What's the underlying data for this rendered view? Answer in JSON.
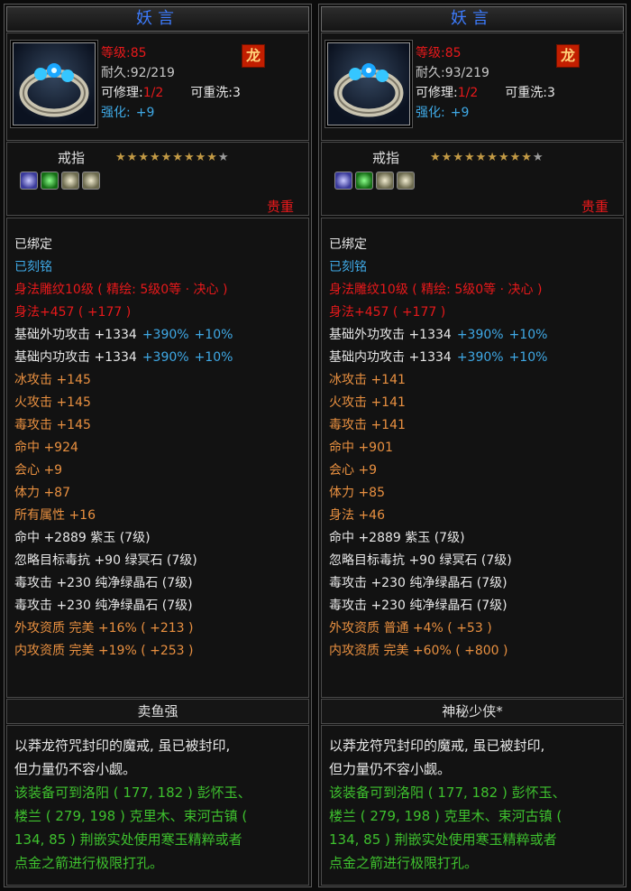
{
  "panels": [
    {
      "title": "妖言",
      "level": "等级:85",
      "durability": "耐久:92/219",
      "repair_label": "可修理:",
      "repair_value": "1/2",
      "rewash": "可重洗:3",
      "enhance_label": "强化:",
      "enhance_value": "+9",
      "emblem_icon": "dragon-icon",
      "type": "戒指",
      "stars_on": 9,
      "stars_total": 10,
      "grade": "贵重",
      "lines": [
        [
          {
            "t": "已绑定",
            "c": "wht"
          }
        ],
        [
          {
            "t": "已刻铭",
            "c": "cyn"
          }
        ],
        [
          {
            "t": "身法雕纹10级 ( 精绘: 5级0等 · 决心 )",
            "c": "red"
          }
        ],
        [
          {
            "t": "身法+457 ( +177 )",
            "c": "red"
          }
        ],
        [
          {
            "t": "基础外功攻击  +1334",
            "c": "wht"
          },
          {
            "t": "+390%",
            "c": "cyn"
          },
          {
            "t": "+10%",
            "c": "cyn"
          }
        ],
        [
          {
            "t": "基础内功攻击  +1334",
            "c": "wht"
          },
          {
            "t": "+390%",
            "c": "cyn"
          },
          {
            "t": "+10%",
            "c": "cyn"
          }
        ],
        [
          {
            "t": "冰攻击  +145",
            "c": "org"
          }
        ],
        [
          {
            "t": "火攻击  +145",
            "c": "org"
          }
        ],
        [
          {
            "t": "毒攻击  +145",
            "c": "org"
          }
        ],
        [
          {
            "t": "命中  +924",
            "c": "org"
          }
        ],
        [
          {
            "t": "会心  +9",
            "c": "org"
          }
        ],
        [
          {
            "t": "体力  +87",
            "c": "org"
          }
        ],
        [
          {
            "t": "所有属性  +16",
            "c": "org"
          }
        ],
        [
          {
            "t": "命中  +2889  紫玉 (7级)",
            "c": "wht"
          }
        ],
        [
          {
            "t": "忽略目标毒抗  +90  绿冥石 (7级)",
            "c": "wht"
          }
        ],
        [
          {
            "t": "毒攻击  +230  纯净绿晶石 (7级)",
            "c": "wht"
          }
        ],
        [
          {
            "t": "毒攻击  +230  纯净绿晶石 (7级)",
            "c": "wht"
          }
        ],
        [
          {
            "t": "外攻资质    完美  +16%  ( +213 )",
            "c": "org"
          }
        ],
        [
          {
            "t": "内攻资质    完美  +19%  ( +253 )",
            "c": "org"
          }
        ]
      ],
      "seller": "卖鱼强",
      "desc": [
        {
          "t": "以莽龙符咒封印的魔戒, 虽已被封印,",
          "c": "wht"
        },
        {
          "t": "但力量仍不容小觑。",
          "c": "wht"
        },
        {
          "t": "该装备可到洛阳 ( 177, 182 ) 彭怀玉、",
          "c": "grn"
        },
        {
          "t": "楼兰 ( 279, 198 ) 克里木、束河古镇 (",
          "c": "grn"
        },
        {
          "t": "134, 85 ) 荆嵌实处使用寒玉精粹或者",
          "c": "grn"
        },
        {
          "t": "点金之箭进行极限打孔。",
          "c": "grn"
        }
      ]
    },
    {
      "title": "妖言",
      "level": "等级:85",
      "durability": "耐久:93/219",
      "repair_label": "可修理:",
      "repair_value": "1/2",
      "rewash": "可重洗:3",
      "enhance_label": "强化:",
      "enhance_value": "+9",
      "emblem_icon": "dragon-icon",
      "type": "戒指",
      "stars_on": 9,
      "stars_total": 10,
      "grade": "贵重",
      "lines": [
        [
          {
            "t": "已绑定",
            "c": "wht"
          }
        ],
        [
          {
            "t": "已刻铭",
            "c": "cyn"
          }
        ],
        [
          {
            "t": "身法雕纹10级 ( 精绘: 5级0等 · 决心 )",
            "c": "red"
          }
        ],
        [
          {
            "t": "身法+457 ( +177 )",
            "c": "red"
          }
        ],
        [
          {
            "t": "基础外功攻击  +1334",
            "c": "wht"
          },
          {
            "t": "+390%",
            "c": "cyn"
          },
          {
            "t": "+10%",
            "c": "cyn"
          }
        ],
        [
          {
            "t": "基础内功攻击  +1334",
            "c": "wht"
          },
          {
            "t": "+390%",
            "c": "cyn"
          },
          {
            "t": "+10%",
            "c": "cyn"
          }
        ],
        [
          {
            "t": "冰攻击  +141",
            "c": "org"
          }
        ],
        [
          {
            "t": "火攻击  +141",
            "c": "org"
          }
        ],
        [
          {
            "t": "毒攻击  +141",
            "c": "org"
          }
        ],
        [
          {
            "t": "命中  +901",
            "c": "org"
          }
        ],
        [
          {
            "t": "会心  +9",
            "c": "org"
          }
        ],
        [
          {
            "t": "体力  +85",
            "c": "org"
          }
        ],
        [
          {
            "t": "身法  +46",
            "c": "org"
          }
        ],
        [
          {
            "t": "命中  +2889  紫玉 (7级)",
            "c": "wht"
          }
        ],
        [
          {
            "t": "忽略目标毒抗  +90  绿冥石 (7级)",
            "c": "wht"
          }
        ],
        [
          {
            "t": "毒攻击  +230  纯净绿晶石 (7级)",
            "c": "wht"
          }
        ],
        [
          {
            "t": "毒攻击  +230  纯净绿晶石 (7级)",
            "c": "wht"
          }
        ],
        [
          {
            "t": "外攻资质    普通  +4%  ( +53 )",
            "c": "org"
          }
        ],
        [
          {
            "t": "内攻资质    完美  +60%  ( +800 )",
            "c": "org"
          }
        ]
      ],
      "seller": "神秘少侠*",
      "desc": [
        {
          "t": "以莽龙符咒封印的魔戒, 虽已被封印,",
          "c": "wht"
        },
        {
          "t": "但力量仍不容小觑。",
          "c": "wht"
        },
        {
          "t": "该装备可到洛阳 ( 177, 182 ) 彭怀玉、",
          "c": "grn"
        },
        {
          "t": "楼兰 ( 279, 198 ) 克里木、束河古镇 (",
          "c": "grn"
        },
        {
          "t": "134, 85 ) 荆嵌实处使用寒玉精粹或者",
          "c": "grn"
        },
        {
          "t": "点金之箭进行极限打孔。",
          "c": "grn"
        }
      ]
    }
  ]
}
